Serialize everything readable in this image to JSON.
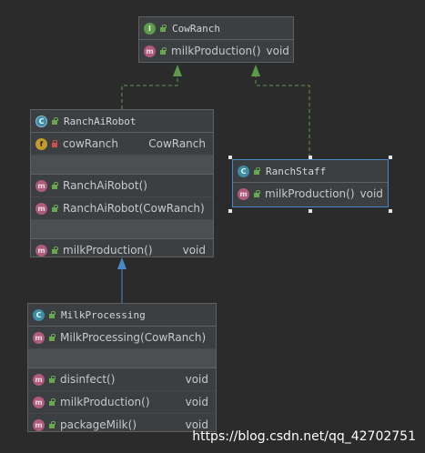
{
  "colors": {
    "background": "#2b2b2b",
    "box": "#3c3f41",
    "implements_edge": "#5d9b4a",
    "extends_edge": "#4a88c7",
    "selection_border": "#4a88c7"
  },
  "cow_ranch": {
    "kind_icon": "interface-icon",
    "name": "CowRanch",
    "methods": [
      {
        "name": "milkProduction()",
        "type": "void",
        "icon": "abstract-method-icon"
      }
    ]
  },
  "ranch_ai_robot": {
    "kind_icon": "abstract-class-icon",
    "name": "RanchAiRobot",
    "fields": [
      {
        "name": "cowRanch",
        "type": "CowRanch",
        "icon": "field-icon"
      }
    ],
    "constructors": [
      {
        "name": "RanchAiRobot()",
        "icon": "method-icon"
      },
      {
        "name": "RanchAiRobot(CowRanch)",
        "icon": "method-icon"
      }
    ],
    "methods": [
      {
        "name": "milkProduction()",
        "type": "void",
        "icon": "method-icon"
      }
    ]
  },
  "ranch_staff": {
    "kind_icon": "class-icon",
    "name": "RanchStaff",
    "methods": [
      {
        "name": "milkProduction()",
        "type": "void",
        "icon": "method-icon"
      }
    ]
  },
  "milk_processing": {
    "kind_icon": "class-icon",
    "name": "MilkProcessing",
    "constructors": [
      {
        "name": "MilkProcessing(CowRanch)",
        "icon": "method-icon"
      }
    ],
    "methods": [
      {
        "name": "disinfect()",
        "type": "void",
        "icon": "method-icon"
      },
      {
        "name": "milkProduction()",
        "type": "void",
        "icon": "method-icon"
      },
      {
        "name": "packageMilk()",
        "type": "void",
        "icon": "method-icon"
      }
    ]
  },
  "watermark": "https://blog.csdn.net/qq_42702751"
}
